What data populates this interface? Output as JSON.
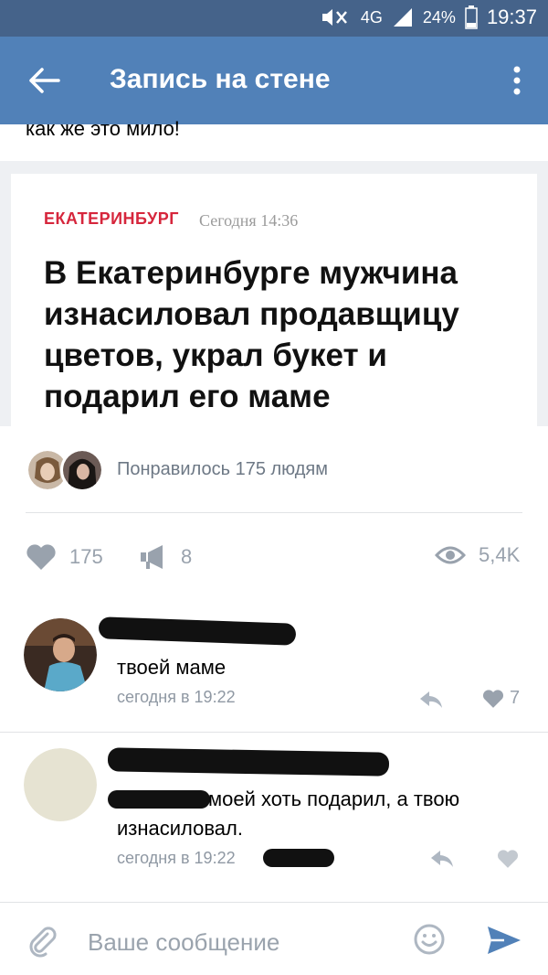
{
  "status": {
    "network": "4G",
    "battery": "24%",
    "time": "19:37"
  },
  "app_bar": {
    "title": "Запись на стене"
  },
  "post": {
    "text": "как же это мило!",
    "news": {
      "city": "ЕКАТЕРИНБУРГ",
      "time": "Сегодня 14:36",
      "headline": "В Екатеринбурге мужчина изнасиловал продавщицу цветов, украл букет и подарил его маме"
    },
    "likes_text": "Понравилось 175 людям",
    "actions": {
      "likes": "175",
      "shares": "8",
      "views": "5,4K"
    }
  },
  "comments": [
    {
      "text": "твоей маме",
      "time": "сегодня в 19:22",
      "likes": "7"
    },
    {
      "text": "моей хоть подарил, а твою изнасиловал.",
      "time": "сегодня в 19:22",
      "likes": ""
    }
  ],
  "input": {
    "placeholder": "Ваше сообщение"
  },
  "colors": {
    "header": "#5181b8",
    "status_bar": "#45638a",
    "accent_red": "#d6263c",
    "icon_gray": "#99a2ad"
  }
}
